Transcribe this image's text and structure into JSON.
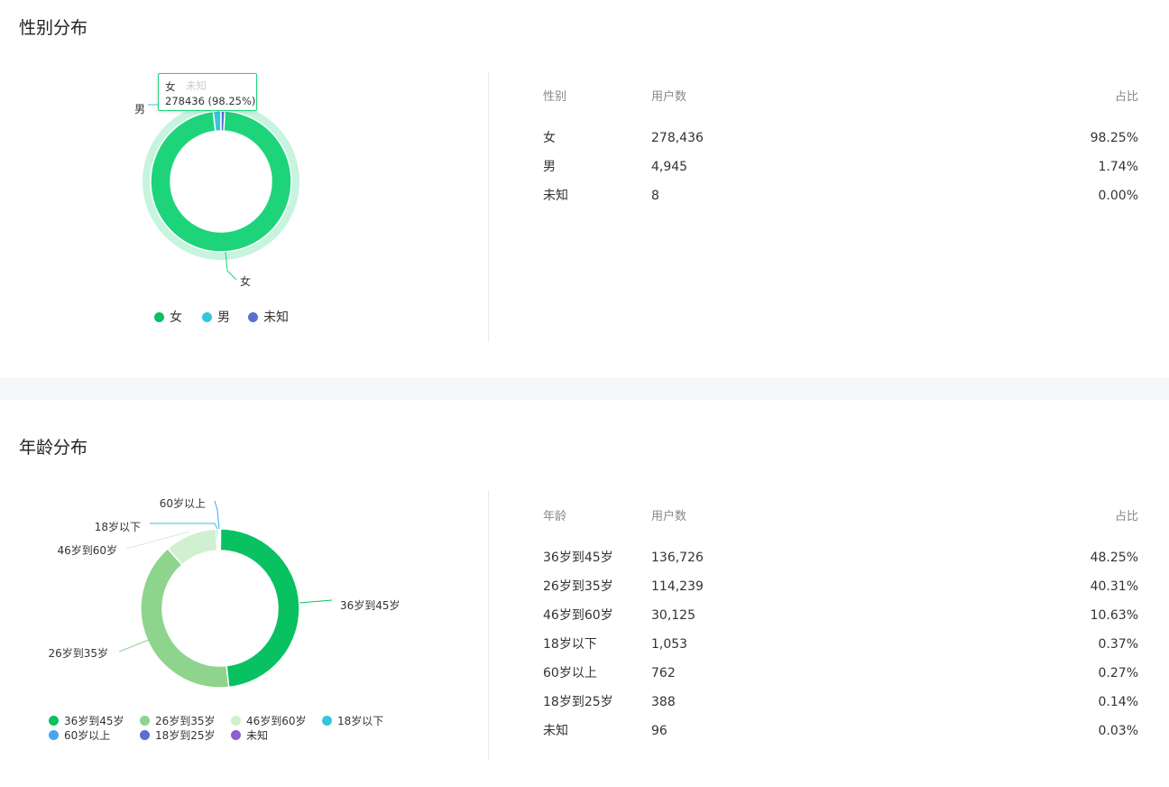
{
  "gender": {
    "title": "性别分布",
    "table": {
      "headers": [
        "性别",
        "用户数",
        "占比"
      ],
      "rows": [
        {
          "label": "女",
          "count": "278,436",
          "pct": "98.25%"
        },
        {
          "label": "男",
          "count": "4,945",
          "pct": "1.74%"
        },
        {
          "label": "未知",
          "count": "8",
          "pct": "0.00%"
        }
      ]
    },
    "tooltip": {
      "label": "女",
      "value": "278436 (98.25%)",
      "ghost_label": "未知"
    },
    "legend": [
      "女",
      "男",
      "未知"
    ]
  },
  "age": {
    "title": "年龄分布",
    "table": {
      "headers": [
        "年龄",
        "用户数",
        "占比"
      ],
      "rows": [
        {
          "label": "36岁到45岁",
          "count": "136,726",
          "pct": "48.25%"
        },
        {
          "label": "26岁到35岁",
          "count": "114,239",
          "pct": "40.31%"
        },
        {
          "label": "46岁到60岁",
          "count": "30,125",
          "pct": "10.63%"
        },
        {
          "label": "18岁以下",
          "count": "1,053",
          "pct": "0.37%"
        },
        {
          "label": "60岁以上",
          "count": "762",
          "pct": "0.27%"
        },
        {
          "label": "18岁到25岁",
          "count": "388",
          "pct": "0.14%"
        },
        {
          "label": "未知",
          "count": "96",
          "pct": "0.03%"
        }
      ]
    },
    "legend": [
      "36岁到45岁",
      "26岁到35岁",
      "46岁到60岁",
      "18岁以下",
      "60岁以上",
      "18岁到25岁",
      "未知"
    ]
  },
  "chart_data": [
    {
      "type": "pie",
      "donut": true,
      "title": "性别分布",
      "categories": [
        "女",
        "男",
        "未知"
      ],
      "values": [
        278436,
        4945,
        8
      ],
      "percentages": [
        98.25,
        1.74,
        0.0
      ],
      "colors": [
        "#1ed47a",
        "#36c6dc",
        "#5b6fd1"
      ],
      "highlighted": "女",
      "legend_position": "bottom"
    },
    {
      "type": "pie",
      "donut": true,
      "title": "年龄分布",
      "categories": [
        "36岁到45岁",
        "26岁到35岁",
        "46岁到60岁",
        "18岁以下",
        "60岁以上",
        "18岁到25岁",
        "未知"
      ],
      "values": [
        136726,
        114239,
        30125,
        1053,
        762,
        388,
        96
      ],
      "percentages": [
        48.25,
        40.31,
        10.63,
        0.37,
        0.27,
        0.14,
        0.03
      ],
      "colors": [
        "#08c160",
        "#8ed48c",
        "#d1efd1",
        "#36c6dc",
        "#48a4f0",
        "#5b6fd1",
        "#8a5fd1"
      ],
      "legend_position": "bottom"
    }
  ]
}
